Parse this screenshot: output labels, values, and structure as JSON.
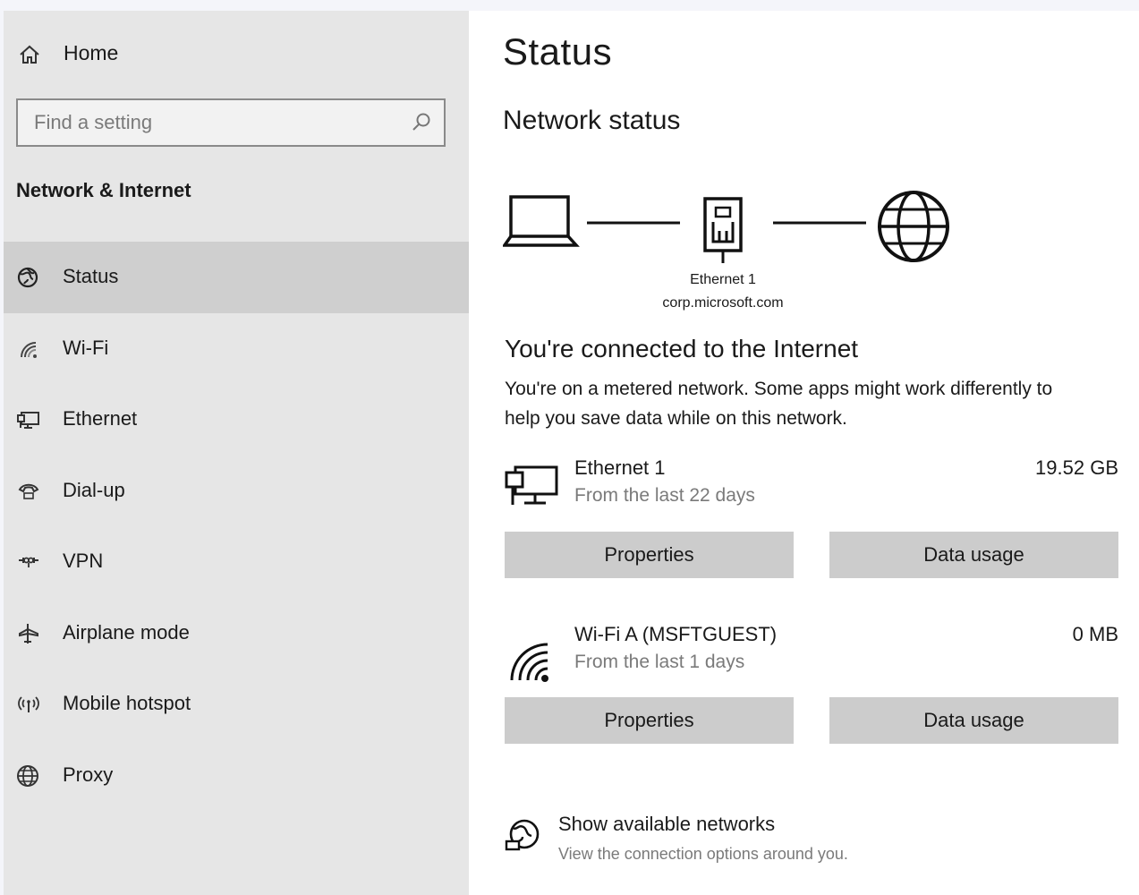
{
  "sidebar": {
    "home_label": "Home",
    "search_placeholder": "Find a setting",
    "section_title": "Network & Internet",
    "items": [
      {
        "label": "Status",
        "icon": "globe-status-icon",
        "active": true
      },
      {
        "label": "Wi-Fi",
        "icon": "wifi-icon"
      },
      {
        "label": "Ethernet",
        "icon": "ethernet-icon"
      },
      {
        "label": "Dial-up",
        "icon": "dialup-icon"
      },
      {
        "label": "VPN",
        "icon": "vpn-icon"
      },
      {
        "label": "Airplane mode",
        "icon": "airplane-icon"
      },
      {
        "label": "Mobile hotspot",
        "icon": "hotspot-icon"
      },
      {
        "label": "Proxy",
        "icon": "globe-icon"
      }
    ]
  },
  "main": {
    "title": "Status",
    "subtitle": "Network status",
    "diagram": {
      "adapter": "Ethernet 1",
      "domain": "corp.microsoft.com"
    },
    "connection_title": "You're connected to the Internet",
    "connection_desc": "You're on a metered network. Some apps might work differently to help you save data while on this network.",
    "networks": [
      {
        "name": "Ethernet 1",
        "subtitle": "From the last 22 days",
        "usage": "19.52 GB",
        "icon": "ethernet-adapter-icon",
        "properties_label": "Properties",
        "data_usage_label": "Data usage"
      },
      {
        "name": "Wi-Fi A (MSFTGUEST)",
        "subtitle": "From the last 1 days",
        "usage": "0 MB",
        "icon": "wifi-signal-icon",
        "properties_label": "Properties",
        "data_usage_label": "Data usage"
      }
    ],
    "show_networks": {
      "title": "Show available networks",
      "desc": "View the connection options around you."
    }
  }
}
